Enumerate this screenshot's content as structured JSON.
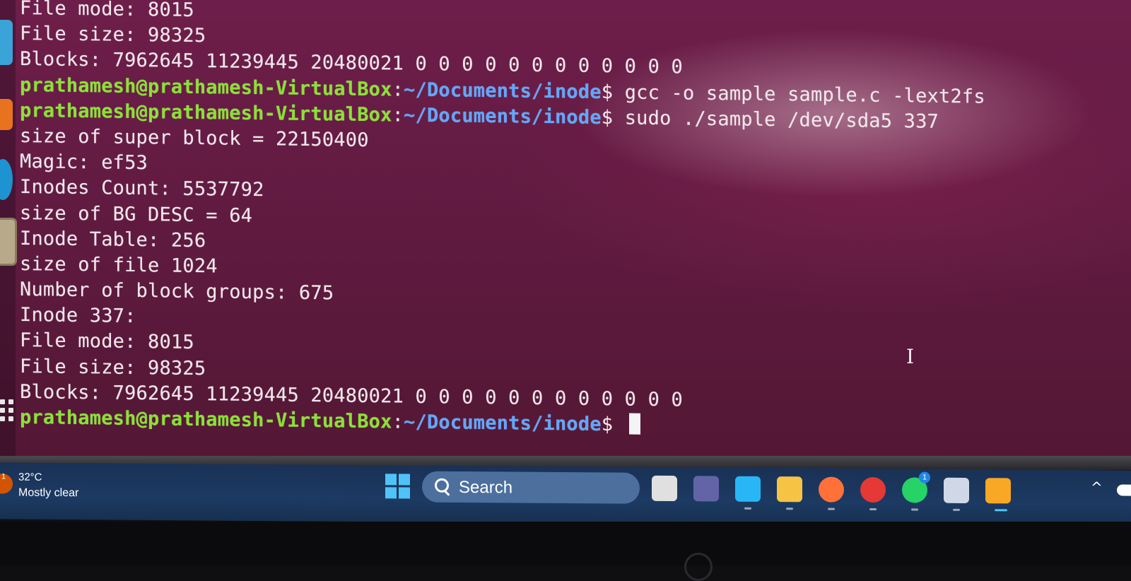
{
  "terminal": {
    "prompt": {
      "user_host": "prathamesh@prathamesh-VirtualBox",
      "separator": ":",
      "path": "~/Documents/inode",
      "symbol": "$"
    },
    "lines": [
      {
        "type": "output",
        "text": "File mode: 8015"
      },
      {
        "type": "output",
        "text": "File size: 98325"
      },
      {
        "type": "output",
        "text": "Blocks: 7962645 11239445 20480021 0 0 0 0 0 0 0 0 0 0 0 0"
      },
      {
        "type": "prompt",
        "command": " gcc -o sample sample.c -lext2fs"
      },
      {
        "type": "prompt",
        "command": " sudo ./sample /dev/sda5 337"
      },
      {
        "type": "output",
        "text": "size of super block = 22150400"
      },
      {
        "type": "output",
        "text": "Magic: ef53"
      },
      {
        "type": "output",
        "text": "Inodes Count: 5537792"
      },
      {
        "type": "output",
        "text": "size of BG DESC = 64"
      },
      {
        "type": "output",
        "text": "Inode Table: 256"
      },
      {
        "type": "output",
        "text": "size of file 1024"
      },
      {
        "type": "output",
        "text": "Number of block groups: 675"
      },
      {
        "type": "output",
        "text": "Inode 337:"
      },
      {
        "type": "output",
        "text": "File mode: 8015"
      },
      {
        "type": "output",
        "text": "File size: 98325"
      },
      {
        "type": "output",
        "text": "Blocks: 7962645 11239445 20480021 0 0 0 0 0 0 0 0 0 0 0 0"
      },
      {
        "type": "prompt",
        "command": " ",
        "cursor": true
      }
    ]
  },
  "taskbar": {
    "weather": {
      "badge": "1",
      "temperature": "32°C",
      "condition": "Mostly clear"
    },
    "search": {
      "label": "Search"
    },
    "apps": [
      {
        "name": "task-view-icon",
        "color": "#e0e0e0"
      },
      {
        "name": "teams-icon",
        "color": "#6264a7"
      },
      {
        "name": "store-icon",
        "color": "#29b6f6"
      },
      {
        "name": "file-explorer-icon",
        "color": "#f6c344"
      },
      {
        "name": "firefox-icon",
        "color": "#ff7139"
      },
      {
        "name": "chrome-icon",
        "color": "#e53935"
      },
      {
        "name": "whatsapp-icon",
        "color": "#25d366",
        "badge": "1"
      },
      {
        "name": "virtualbox-icon",
        "color": "#d0d8e8"
      },
      {
        "name": "vm-window-icon",
        "color": "#f9a825"
      }
    ]
  }
}
